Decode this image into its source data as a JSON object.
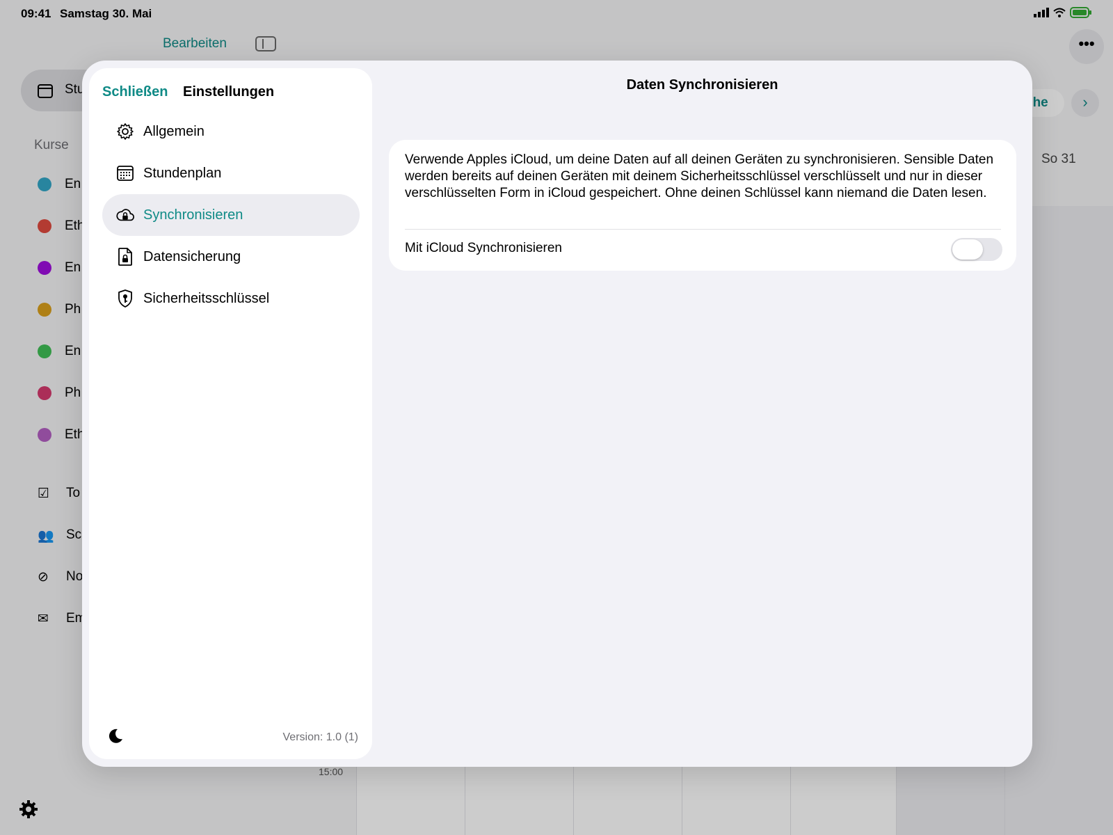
{
  "status_bar": {
    "time": "09:41",
    "date": "Samstag 30. Mai"
  },
  "background": {
    "edit_label": "Bearbeiten",
    "pill_label": "Stu",
    "section_label": "Kurse",
    "courses": [
      {
        "label": "En",
        "color": "#32a7c7"
      },
      {
        "label": "Eth",
        "color": "#e04a3f"
      },
      {
        "label": "En",
        "color": "#a10ee0"
      },
      {
        "label": "Ph",
        "color": "#dba11c"
      },
      {
        "label": "En",
        "color": "#40c057"
      },
      {
        "label": "Ph",
        "color": "#d63a6f"
      },
      {
        "label": "Eth",
        "color": "#b560c4"
      }
    ],
    "menu": [
      {
        "label": "To",
        "icon": "checklist-icon"
      },
      {
        "label": "Sc",
        "icon": "people-icon"
      },
      {
        "label": "No",
        "icon": "no-entry-icon"
      },
      {
        "label": "Em",
        "icon": "envelope-icon"
      }
    ],
    "week_button": "che",
    "day_label": "So 31",
    "hour_label": "15:00"
  },
  "modal": {
    "close_label": "Schließen",
    "title": "Einstellungen",
    "nav": [
      {
        "label": "Allgemein",
        "icon": "gear-icon",
        "active": false
      },
      {
        "label": "Stundenplan",
        "icon": "calendar-icon",
        "active": false
      },
      {
        "label": "Synchronisieren",
        "icon": "cloud-lock-icon",
        "active": true
      },
      {
        "label": "Datensicherung",
        "icon": "document-lock-icon",
        "active": false
      },
      {
        "label": "Sicherheitsschlüssel",
        "icon": "shield-key-icon",
        "active": false
      }
    ],
    "version": "Version: 1.0 (1)",
    "detail": {
      "title": "Daten Synchronisieren",
      "description": "Verwende Apples iCloud, um deine Daten auf all deinen Geräten zu synchronisieren. Sensible Daten werden bereits auf deinen Geräten mit deinem Sicherheitsschlüssel verschlüsselt und nur in dieser verschlüsselten Form in iCloud gespeichert. Ohne deinen Schlüssel kann niemand die Daten lesen.",
      "toggle_label": "Mit iCloud Synchronisieren",
      "toggle_on": false
    }
  },
  "colors": {
    "accent": "#0f8a86"
  }
}
